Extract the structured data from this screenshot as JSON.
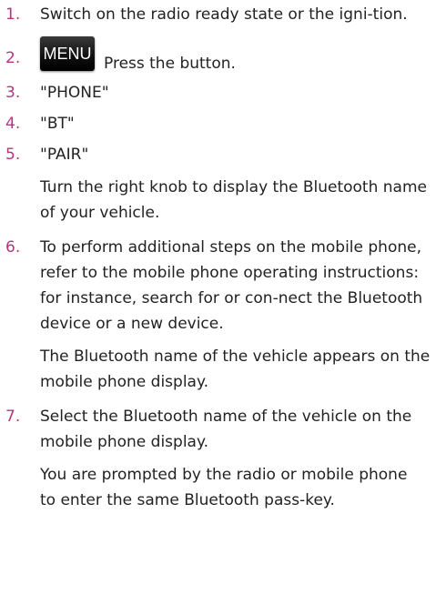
{
  "colors": {
    "step_number": "#b4367e",
    "menu_button_bg": "#111111",
    "text": "#222222"
  },
  "steps": [
    {
      "number": "1.",
      "text": "Switch on the radio ready state or the igni-tion."
    },
    {
      "number": "2.",
      "button_label": "MENU",
      "text": "Press the button."
    },
    {
      "number": "3.",
      "text": "\"PHONE\""
    },
    {
      "number": "4.",
      "text": "\"BT\""
    },
    {
      "number": "5.",
      "text": "\"PAIR\"",
      "result": "Turn the right knob to display the Bluetooth name of your vehicle."
    },
    {
      "number": "6.",
      "text": "To perform additional steps on the mobile phone, refer to the mobile phone operating instructions: for instance, search for or con-nect the Bluetooth device or a new device.",
      "result": "The Bluetooth name of the vehicle appears on the mobile phone display."
    },
    {
      "number": "7.",
      "text": "Select the Bluetooth name of the vehicle on the mobile phone display.",
      "result": "You are prompted by the radio or mobile phone to enter the same Bluetooth pass-key."
    }
  ]
}
